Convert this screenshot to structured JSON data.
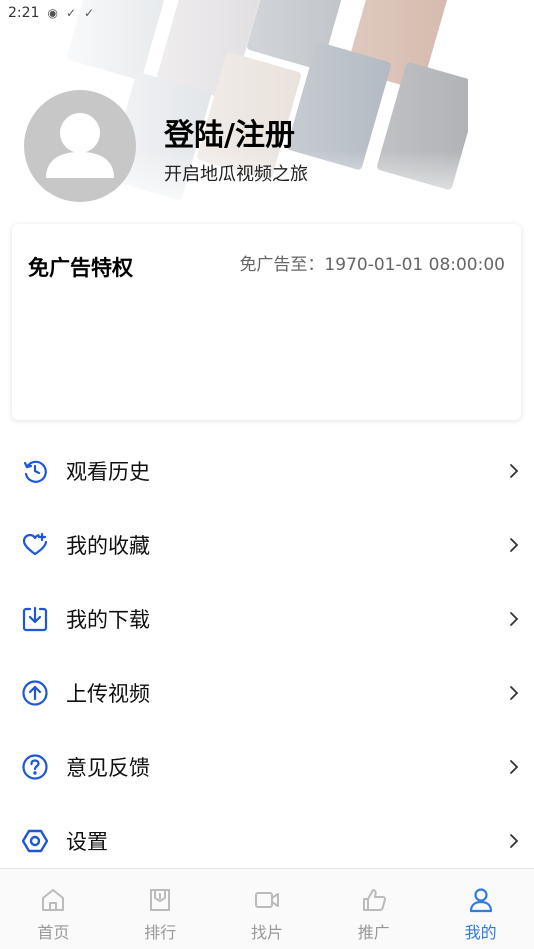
{
  "status_bar": {
    "time": "2:21"
  },
  "profile": {
    "title": "登陆/注册",
    "subtitle": "开启地瓜视频之旅"
  },
  "vip": {
    "title": "免广告特权",
    "expire": "免广告至：1970-01-01 08:00:00"
  },
  "menu": {
    "items": [
      {
        "label": "观看历史",
        "icon": "history-icon"
      },
      {
        "label": "我的收藏",
        "icon": "heart-plus-icon"
      },
      {
        "label": "我的下载",
        "icon": "download-icon"
      },
      {
        "label": "上传视频",
        "icon": "upload-icon"
      },
      {
        "label": "意见反馈",
        "icon": "question-icon"
      },
      {
        "label": "设置",
        "icon": "settings-icon"
      }
    ]
  },
  "bottom_nav": {
    "items": [
      {
        "label": "首页",
        "icon": "home-icon"
      },
      {
        "label": "排行",
        "icon": "ranking-icon"
      },
      {
        "label": "找片",
        "icon": "video-camera-icon"
      },
      {
        "label": "推广",
        "icon": "thumbs-up-icon"
      },
      {
        "label": "我的",
        "icon": "user-icon"
      }
    ],
    "active_index": 4
  },
  "colors": {
    "accent": "#2f7de1",
    "menu_icon": "#1e56d8",
    "nav_inactive": "#999999"
  }
}
